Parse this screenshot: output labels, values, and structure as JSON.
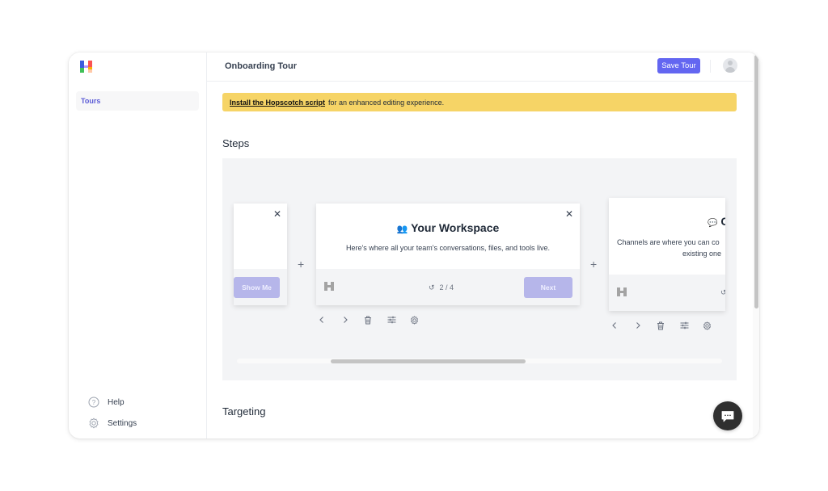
{
  "app": {
    "logo_name": "hopscotch-logo"
  },
  "sidebar": {
    "items": [
      {
        "label": "Tours",
        "active": true
      }
    ],
    "bottom_items": [
      {
        "label": "Help",
        "icon": "help-circle-icon"
      },
      {
        "label": "Settings",
        "icon": "gear-icon"
      }
    ]
  },
  "header": {
    "title": "Onboarding Tour",
    "save_label": "Save Tour",
    "accent_color": "#6366f1"
  },
  "banner": {
    "link_text": "Install the Hopscotch script",
    "rest_text": "for an enhanced editing experience.",
    "color": "#f6d466"
  },
  "sections": {
    "steps_title": "Steps",
    "targeting_title": "Targeting"
  },
  "steps": [
    {
      "partial": "left",
      "title": "",
      "body": ".",
      "button_label": "Show Me"
    },
    {
      "title_icon": "👥",
      "title": "Your Workspace",
      "body": "Here's where all your team's conversations, files, and tools live.",
      "counter": "2 / 4",
      "button_label": "Next"
    },
    {
      "partial": "right",
      "title_icon": "💬",
      "title": "C",
      "body_line1": "Channels are where you can co",
      "body_line2": "existing one"
    }
  ],
  "step_tools": [
    {
      "name": "prev-step-icon",
      "glyph": "‹"
    },
    {
      "name": "next-step-icon",
      "glyph": "›"
    },
    {
      "name": "trash-icon"
    },
    {
      "name": "sliders-icon"
    },
    {
      "name": "gear-icon"
    }
  ]
}
